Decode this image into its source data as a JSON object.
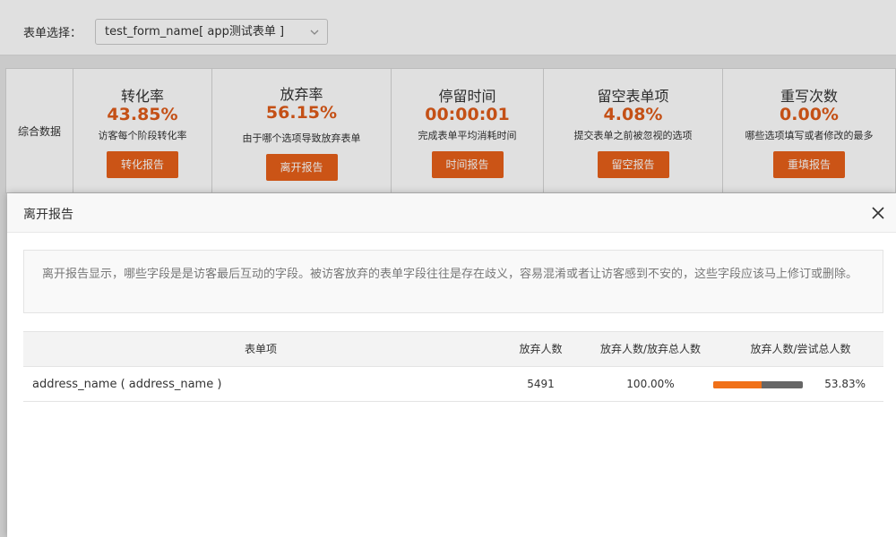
{
  "toolbar": {
    "form_label": "表单选择：",
    "form_select_value": "test_form_name[ app测试表单 ]"
  },
  "summary": {
    "head_label": "综合数据",
    "metrics": [
      {
        "title": "转化率",
        "value": "43.85%",
        "desc": "访客每个阶段转化率",
        "button": "转化报告"
      },
      {
        "title": "放弃率",
        "value": "56.15%",
        "desc": "由于哪个选项导致放弃表单",
        "button": "离开报告"
      },
      {
        "title": "停留时间",
        "value": "00:00:01",
        "desc": "完成表单平均消耗时间",
        "button": "时间报告"
      },
      {
        "title": "留空表单项",
        "value": "4.08%",
        "desc": "提交表单之前被忽视的选项",
        "button": "留空报告"
      },
      {
        "title": "重写次数",
        "value": "0.00%",
        "desc": "哪些选项填写或者修改的最多",
        "button": "重填报告"
      }
    ]
  },
  "dialog": {
    "title": "离开报告",
    "notice": "离开报告显示，哪些字段是是访客最后互动的字段。被访客放弃的表单字段往往是存在歧义，容易混淆或者让访客感到不安的，这些字段应该马上修订或删除。",
    "table": {
      "headers": {
        "item": "表单项",
        "abandon_count": "放弃人数",
        "abandon_ratio_total": "放弃人数/放弃总人数",
        "abandon_ratio_try": "放弃人数/尝试总人数"
      },
      "rows": [
        {
          "item": "address_name ( address_name )",
          "abandon_count": "5491",
          "abandon_ratio_total": "100.00%",
          "abandon_ratio_try": "53.83%",
          "bar_fraction": 0.5383
        }
      ]
    }
  },
  "colors": {
    "accent": "#e8601a",
    "value_text": "#e05c1a",
    "bar_fill": "#f07018",
    "bar_track": "#666666"
  }
}
